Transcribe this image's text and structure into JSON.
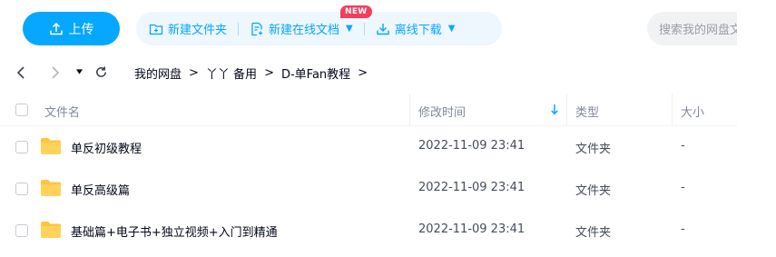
{
  "toolbar": {
    "upload_label": "上传",
    "new_folder_label": "新建文件夹",
    "new_online_doc_label": "新建在线文档",
    "new_badge": "NEW",
    "offline_download_label": "离线下载",
    "search_placeholder": "搜索我的网盘文件"
  },
  "breadcrumb": {
    "items": [
      "我的网盘",
      "丫丫 备用",
      "D-单Fan教程"
    ],
    "separator": ">"
  },
  "table": {
    "headers": {
      "name": "文件名",
      "modified": "修改时间",
      "type": "类型",
      "size": "大小"
    },
    "rows": [
      {
        "name": "单反初级教程",
        "modified": "2022-11-09 23:41",
        "type": "文件夹",
        "size": "-"
      },
      {
        "name": "单反高级篇",
        "modified": "2022-11-09 23:41",
        "type": "文件夹",
        "size": "-"
      },
      {
        "name": "基础篇+电子书+独立视频+入门到精通",
        "modified": "2022-11-09 23:41",
        "type": "文件夹",
        "size": "-"
      }
    ]
  },
  "colors": {
    "accent": "#06a7ff",
    "accent_bg": "#eef6fe",
    "badge": "#f63d5b",
    "folder": "#ffc53d"
  },
  "icons": [
    "upload-icon",
    "new-folder-icon",
    "new-doc-icon",
    "download-icon",
    "back-icon",
    "forward-icon",
    "dropdown-icon",
    "refresh-icon",
    "sort-down-icon",
    "folder-icon"
  ]
}
